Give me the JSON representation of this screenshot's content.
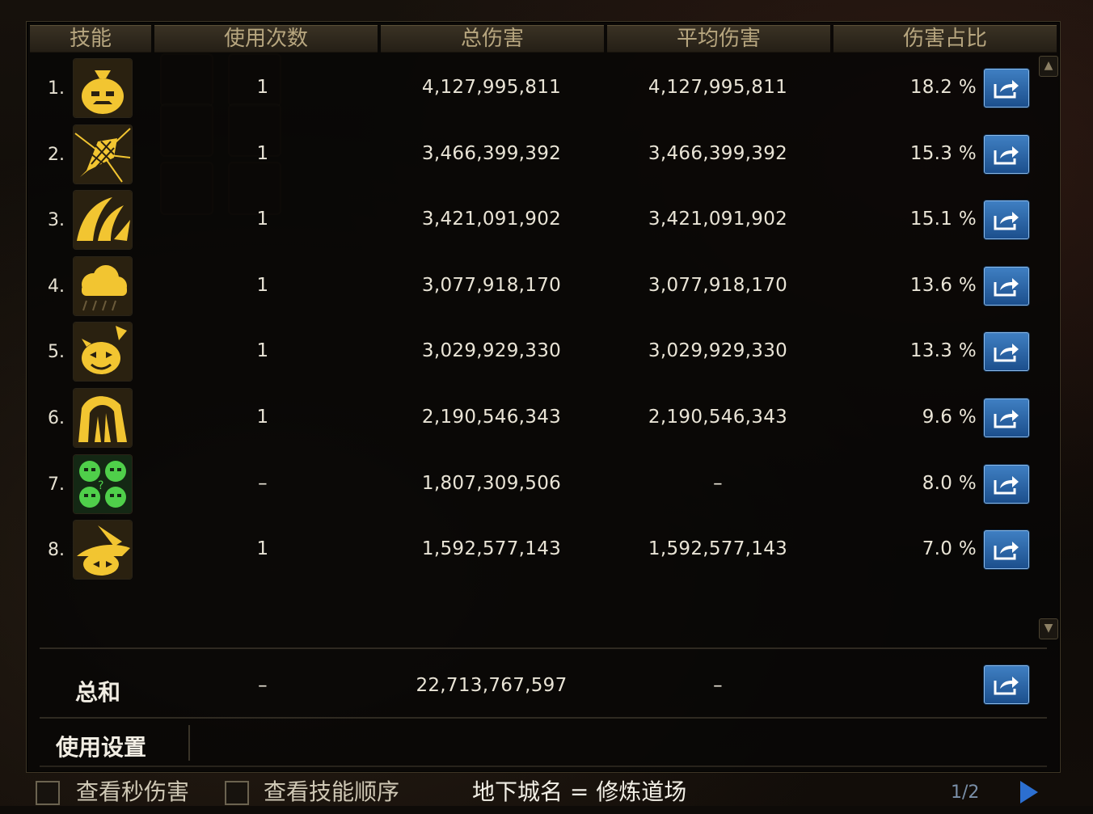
{
  "headers": {
    "skill": "技能",
    "uses": "使用次数",
    "total": "总伤害",
    "avg": "平均伤害",
    "pct": "伤害占比"
  },
  "rows": [
    {
      "rank": "1.",
      "icon": "money-bag-skill-icon",
      "uses": "1",
      "total": "4,127,995,811",
      "avg": "4,127,995,811",
      "pct": "18.2 %"
    },
    {
      "rank": "2.",
      "icon": "net-burst-skill-icon",
      "uses": "1",
      "total": "3,466,399,392",
      "avg": "3,466,399,392",
      "pct": "15.3 %"
    },
    {
      "rank": "3.",
      "icon": "wind-slash-skill-icon",
      "uses": "1",
      "total": "3,421,091,902",
      "avg": "3,421,091,902",
      "pct": "15.1 %"
    },
    {
      "rank": "4.",
      "icon": "storm-cloud-skill-icon",
      "uses": "1",
      "total": "3,077,918,170",
      "avg": "3,077,918,170",
      "pct": "13.6 %"
    },
    {
      "rank": "5.",
      "icon": "pumpkin-skill-icon",
      "uses": "1",
      "total": "3,029,929,330",
      "avg": "3,029,929,330",
      "pct": "13.3 %"
    },
    {
      "rank": "6.",
      "icon": "arch-skill-icon",
      "uses": "1",
      "total": "2,190,546,343",
      "avg": "2,190,546,343",
      "pct": "9.6 %"
    },
    {
      "rank": "7.",
      "icon": "goblin-group-skill-icon",
      "uses": "–",
      "total": "1,807,309,506",
      "avg": "–",
      "pct": "8.0 %"
    },
    {
      "rank": "8.",
      "icon": "witch-hat-skill-icon",
      "uses": "1",
      "total": "1,592,577,143",
      "avg": "1,592,577,143",
      "pct": "7.0 %"
    }
  ],
  "summary": {
    "label": "总和",
    "uses": "–",
    "total": "22,713,767,597",
    "avg": "–"
  },
  "settings_label": "使用设置",
  "bottom": {
    "view_per_second": "查看秒伤害",
    "view_skill_order": "查看技能顺序",
    "dungeon": "地下城名 = 修炼道场",
    "page": "1/2"
  },
  "colors": {
    "gold_icon": "#f2c531",
    "green_icon": "#4fcf4a",
    "share_blue": "#2f6bb0"
  }
}
